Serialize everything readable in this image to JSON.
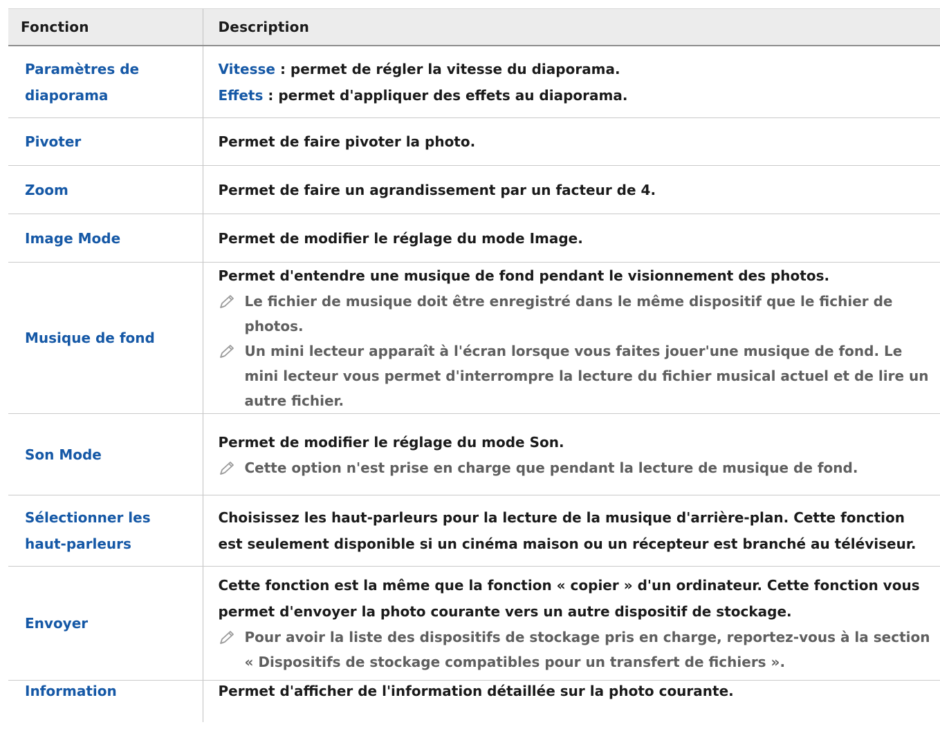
{
  "table": {
    "header": {
      "col1": "Fonction",
      "col2": "Description"
    },
    "rows": [
      {
        "function": "Paramètres de diaporama",
        "lines": [
          {
            "term": "Vitesse",
            "text": " : permet de régler la vitesse du diaporama."
          },
          {
            "term": "Effets",
            "text": " : permet d'appliquer des effets au diaporama."
          }
        ]
      },
      {
        "function": "Pivoter",
        "text": "Permet de faire pivoter la photo."
      },
      {
        "function": "Zoom",
        "text": "Permet de faire un agrandissement par un facteur de 4."
      },
      {
        "function": "Image Mode",
        "text": "Permet de modifier le réglage du mode Image."
      },
      {
        "function": "Musique de fond",
        "text": "Permet d'entendre une musique de fond pendant le visionnement des photos.",
        "notes": [
          "Le fichier de musique doit être enregistré dans le même dispositif que le fichier de photos.",
          "Un mini lecteur apparaît à l'écran lorsque vous faites jouer'une musique de fond. Le mini lecteur vous permet d'interrompre la lecture du fichier musical actuel et de lire un autre fichier."
        ]
      },
      {
        "function": "Son Mode",
        "text": "Permet de modifier le réglage du mode Son.",
        "notes": [
          "Cette option n'est prise en charge que pendant la lecture de musique de fond."
        ]
      },
      {
        "function": "Sélectionner les haut-parleurs",
        "text": "Choisissez les haut-parleurs pour la lecture de la musique d'arrière-plan. Cette fonction est seulement disponible si un cinéma maison ou un récepteur est branché au téléviseur."
      },
      {
        "function": "Envoyer",
        "text": "Cette fonction est la même que la fonction « copier » d'un ordinateur. Cette fonction vous permet d'envoyer la photo courante vers un autre dispositif de stockage.",
        "notes": [
          "Pour avoir la liste des dispositifs de stockage pris en charge, reportez-vous à la section « Dispositifs de stockage compatibles pour un transfert de fichiers »."
        ]
      },
      {
        "function": "Information",
        "text": "Permet d'afficher de l'information détaillée sur la photo courante."
      }
    ],
    "note_icon": "pencil-note-icon",
    "colors": {
      "accent": "#1558a6",
      "header_bg": "#ececec",
      "note_text": "#5f5f5f"
    }
  }
}
